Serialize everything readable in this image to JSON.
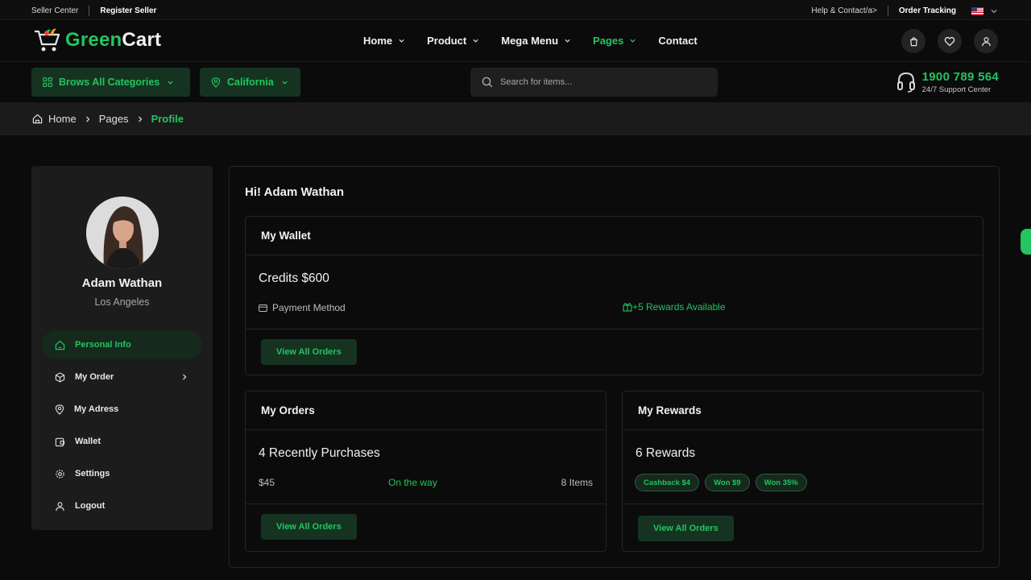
{
  "topbar": {
    "seller_center": "Seller Center",
    "register_seller": "Register Seller",
    "help_contact": "Help & Contact/a>",
    "order_tracking": "Order Tracking"
  },
  "brand": {
    "name_part1": "Green",
    "name_part2": "Cart",
    "accent_color": "#22c55e"
  },
  "nav": {
    "home": "Home",
    "product": "Product",
    "mega_menu": "Mega Menu",
    "pages": "Pages",
    "contact": "Contact"
  },
  "categories_button": "Brows All Categories",
  "location_button": "California",
  "search": {
    "placeholder": "Search for items..."
  },
  "support": {
    "phone": "1900 789 564",
    "label": "24/7 Support Center"
  },
  "breadcrumb": {
    "home": "Home",
    "pages": "Pages",
    "current": "Profile"
  },
  "profile": {
    "name": "Adam Wathan",
    "location": "Los Angeles"
  },
  "sidebar_menu": {
    "personal_info": "Personal Info",
    "my_order": "My Order",
    "my_address": "My Adress",
    "wallet": "Wallet",
    "settings": "Settings",
    "logout": "Logout"
  },
  "main": {
    "greeting": "Hi! Adam Wathan",
    "wallet": {
      "title": "My Wallet",
      "credits": "Credits $600",
      "payment_method": "Payment Method",
      "rewards_available": "+5 Rewards Available",
      "button": "View All Orders"
    },
    "orders": {
      "title": "My Orders",
      "summary": "4 Recently Purchases",
      "price": "$45",
      "status": "On the way",
      "items": "8 Items",
      "button": "View All Orders"
    },
    "rewards": {
      "title": "My Rewards",
      "summary": "6 Rewards",
      "tags": [
        "Cashback $4",
        "Won $9",
        "Won 35%"
      ],
      "button": "View All Orders"
    }
  }
}
